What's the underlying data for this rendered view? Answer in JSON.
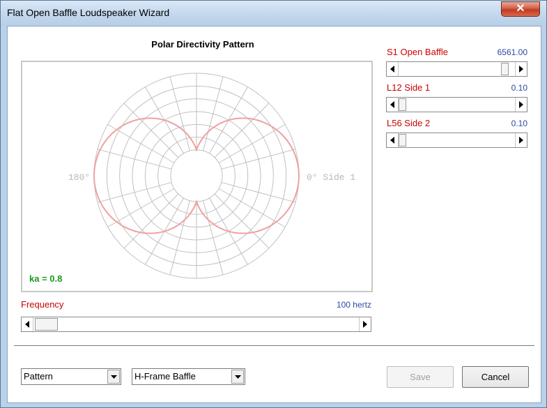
{
  "window": {
    "title": "Flat Open Baffle Loudspeaker Wizard",
    "close_glyph": "✕"
  },
  "chart": {
    "title": "Polar Directivity Pattern",
    "left_label": "180°",
    "right_label": "0° Side 1",
    "ka_label": "ka = 0.8",
    "ka_color": "#1a9a1a",
    "curve_color": "#f0a0a0",
    "grid_color": "#c0c0c0"
  },
  "chart_data": {
    "type": "polar",
    "title": "Polar Directivity Pattern",
    "angle_labels": [
      "180°",
      "0° Side 1"
    ],
    "pattern": "dipole (figure-eight)",
    "ka": 0.8
  },
  "params": [
    {
      "label": "S1  Open Baffle",
      "value": "6561.00",
      "position": 0.96
    },
    {
      "label": "L12  Side 1",
      "value": "0.10",
      "position": 0.0
    },
    {
      "label": "L56  Side 2",
      "value": "0.10",
      "position": 0.0
    }
  ],
  "frequency": {
    "label": "Frequency",
    "value": "100 hertz",
    "position": 0.04
  },
  "view_select": {
    "value": "Pattern"
  },
  "baffle_select": {
    "value": "H-Frame Baffle"
  },
  "buttons": {
    "save": "Save",
    "cancel": "Cancel"
  },
  "colors": {
    "param_label": "#cc0000",
    "param_value": "#2a4aa0"
  }
}
